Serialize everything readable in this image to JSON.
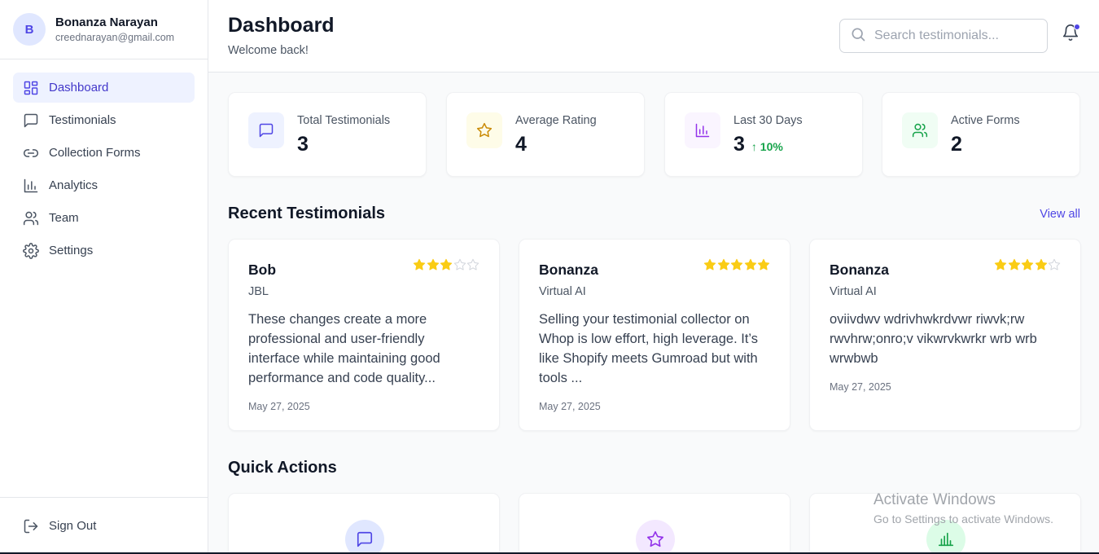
{
  "user": {
    "initial": "B",
    "name": "Bonanza Narayan",
    "email": "creednarayan@gmail.com"
  },
  "sidebar": {
    "items": [
      {
        "label": "Dashboard",
        "icon": "dashboard-icon",
        "active": true
      },
      {
        "label": "Testimonials",
        "icon": "message-icon"
      },
      {
        "label": "Collection Forms",
        "icon": "link-icon"
      },
      {
        "label": "Analytics",
        "icon": "bar-chart-icon"
      },
      {
        "label": "Team",
        "icon": "users-icon"
      },
      {
        "label": "Settings",
        "icon": "gear-icon"
      }
    ],
    "sign_out": "Sign Out"
  },
  "header": {
    "title": "Dashboard",
    "subtitle": "Welcome back!",
    "search_placeholder": "Search testimonials..."
  },
  "stats": [
    {
      "label": "Total Testimonials",
      "value": "3",
      "icon": "message-icon",
      "color": "#4f46e5",
      "bg": "#eef2ff"
    },
    {
      "label": "Average Rating",
      "value": "4",
      "icon": "star-icon",
      "color": "#ca8a04",
      "bg": "#fefce8"
    },
    {
      "label": "Last 30 Days",
      "value": "3",
      "change": "10%",
      "icon": "bar-chart-icon",
      "color": "#9333ea",
      "bg": "#faf5ff"
    },
    {
      "label": "Active Forms",
      "value": "2",
      "icon": "users-icon",
      "color": "#16a34a",
      "bg": "#f0fdf4"
    }
  ],
  "recent": {
    "title": "Recent Testimonials",
    "view_all": "View all",
    "items": [
      {
        "name": "Bob",
        "company": "JBL",
        "rating": 3,
        "text": "These changes create a more professional and user-friendly interface while maintaining good performance and code quality...",
        "date": "May 27, 2025"
      },
      {
        "name": "Bonanza",
        "company": "Virtual AI",
        "rating": 5,
        "text": "Selling your testimonial collector on Whop is low effort, high leverage. It’s like Shopify meets Gumroad but with tools ...",
        "date": "May 27, 2025"
      },
      {
        "name": "Bonanza",
        "company": "Virtual AI",
        "rating": 4,
        "text": "oviivdwv wdrivhwkrdvwr riwvk;rw rwvhrw;onro;v vikwrvkwrkr wrb wrb wrwbwb",
        "date": "May 27, 2025"
      }
    ]
  },
  "quick_actions": {
    "title": "Quick Actions",
    "items": [
      {
        "icon": "message-icon",
        "color": "#4f46e5",
        "bg": "#e0e7ff"
      },
      {
        "icon": "star-icon",
        "color": "#9333ea",
        "bg": "#f3e8ff"
      },
      {
        "icon": "bar-chart-icon",
        "color": "#16a34a",
        "bg": "#dcfce7"
      }
    ]
  },
  "colors": {
    "accent": "#4f46e5",
    "star": "#facc15",
    "star_empty": "#d1d5db",
    "positive": "#16a34a"
  },
  "watermark": {
    "title": "Activate Windows",
    "subtitle": "Go to Settings to activate Windows."
  }
}
